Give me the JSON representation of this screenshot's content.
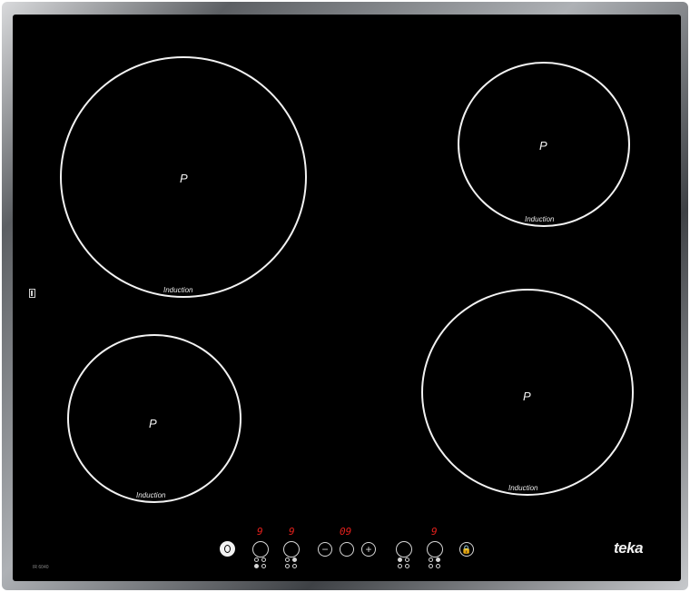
{
  "zones": [
    {
      "id": "rear-left",
      "power": "P",
      "label": "Induction"
    },
    {
      "id": "rear-right",
      "power": "P",
      "label": "Induction"
    },
    {
      "id": "front-left",
      "power": "P",
      "label": "Induction"
    },
    {
      "id": "front-right",
      "power": "P",
      "label": "Induction"
    }
  ],
  "controls": {
    "displays": [
      "9",
      "9",
      "09",
      "9"
    ],
    "minus_symbol": "−",
    "plus_symbol": "+",
    "timer_icon": "clock-icon",
    "lock_icon": "lock-icon"
  },
  "model": "IR 6040",
  "brand": "teka",
  "colors": {
    "display": "#e4201c",
    "glass": "#000000",
    "markings": "#f2f2f2"
  }
}
